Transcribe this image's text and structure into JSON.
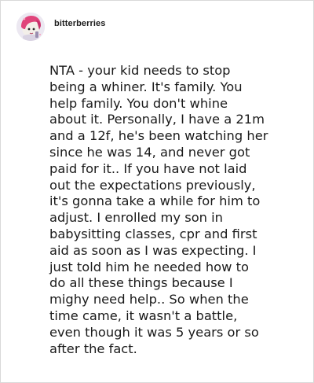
{
  "post": {
    "username": "bitterberries",
    "avatar_icon": "user-avatar-icon",
    "lines": [
      "NTA - your kid needs to stop",
      "being a whiner. It's family. You",
      "help family. You don't whine",
      "about it. Personally, I have a 21m",
      "and a 12f, he's been watching her",
      "since he was 14, and never got",
      "paid for it.. If you have not laid",
      "out the expectations previously,",
      "it's gonna take a while for him to",
      "adjust. I enrolled my son in",
      "babysitting classes, cpr and first",
      "aid as soon as I was expecting. I",
      "just told him he needed how to",
      "do all these things because I",
      "mighy need help.. So when the",
      "time came, it wasn't a battle,",
      "even though it was 5 years or so",
      "after the fact."
    ]
  },
  "colors": {
    "text": "#1a1a1a",
    "border": "#d9d9d9",
    "avatar_hair": "#e0457b",
    "avatar_bg": "#e9e4ef"
  }
}
